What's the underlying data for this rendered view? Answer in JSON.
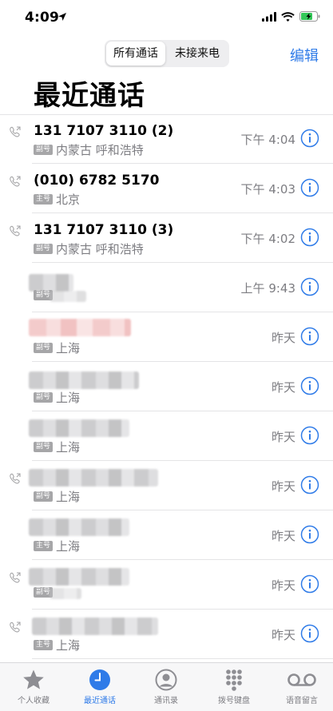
{
  "status_bar": {
    "time": "4:09"
  },
  "header": {
    "segments": [
      {
        "label": "所有通话",
        "selected": true
      },
      {
        "label": "未接来电",
        "selected": false
      }
    ],
    "edit_label": "编辑",
    "title": "最近通话"
  },
  "calls": [
    {
      "name": "131 7107 3110 (2)",
      "sim": "副号",
      "location": "内蒙古 呼和浩特",
      "time": "下午 4:04",
      "outgoing": true
    },
    {
      "name": "(010) 6782 5170",
      "sim": "主号",
      "location": "北京",
      "time": "下午 4:03",
      "outgoing": true
    },
    {
      "name": "131 7107 3110 (3)",
      "sim": "副号",
      "location": "内蒙古 呼和浩特",
      "time": "下午 4:02",
      "outgoing": true
    },
    {
      "name": "",
      "sim": "副号",
      "location": "",
      "time": "上午 9:43",
      "outgoing": false
    },
    {
      "name": "",
      "sim": "副号",
      "location": "上海",
      "time": "昨天",
      "outgoing": false
    },
    {
      "name": "",
      "sim": "副号",
      "location": "上海",
      "time": "昨天",
      "outgoing": false
    },
    {
      "name": "",
      "sim": "副号",
      "location": "上海",
      "time": "昨天",
      "outgoing": false
    },
    {
      "name": "",
      "sim": "副号",
      "location": "上海",
      "time": "昨天",
      "outgoing": true
    },
    {
      "name": "",
      "sim": "主号",
      "location": "上海",
      "time": "昨天",
      "outgoing": false
    },
    {
      "name": "",
      "sim": "副号",
      "location": "",
      "time": "昨天",
      "outgoing": true
    },
    {
      "name": "",
      "sim": "主号",
      "location": "上海",
      "time": "昨天",
      "outgoing": true
    }
  ],
  "tab_bar": {
    "tabs": [
      {
        "label": "个人收藏",
        "icon": "star-icon",
        "active": false
      },
      {
        "label": "最近通话",
        "icon": "clock-icon",
        "active": true
      },
      {
        "label": "通讯录",
        "icon": "contacts-icon",
        "active": false
      },
      {
        "label": "拨号键盘",
        "icon": "keypad-icon",
        "active": false
      },
      {
        "label": "语音留言",
        "icon": "voicemail-icon",
        "active": false
      }
    ]
  },
  "colors": {
    "accent": "#2f7be8",
    "secondary_text": "#7d7d82",
    "badge": "#a6a6a8"
  }
}
